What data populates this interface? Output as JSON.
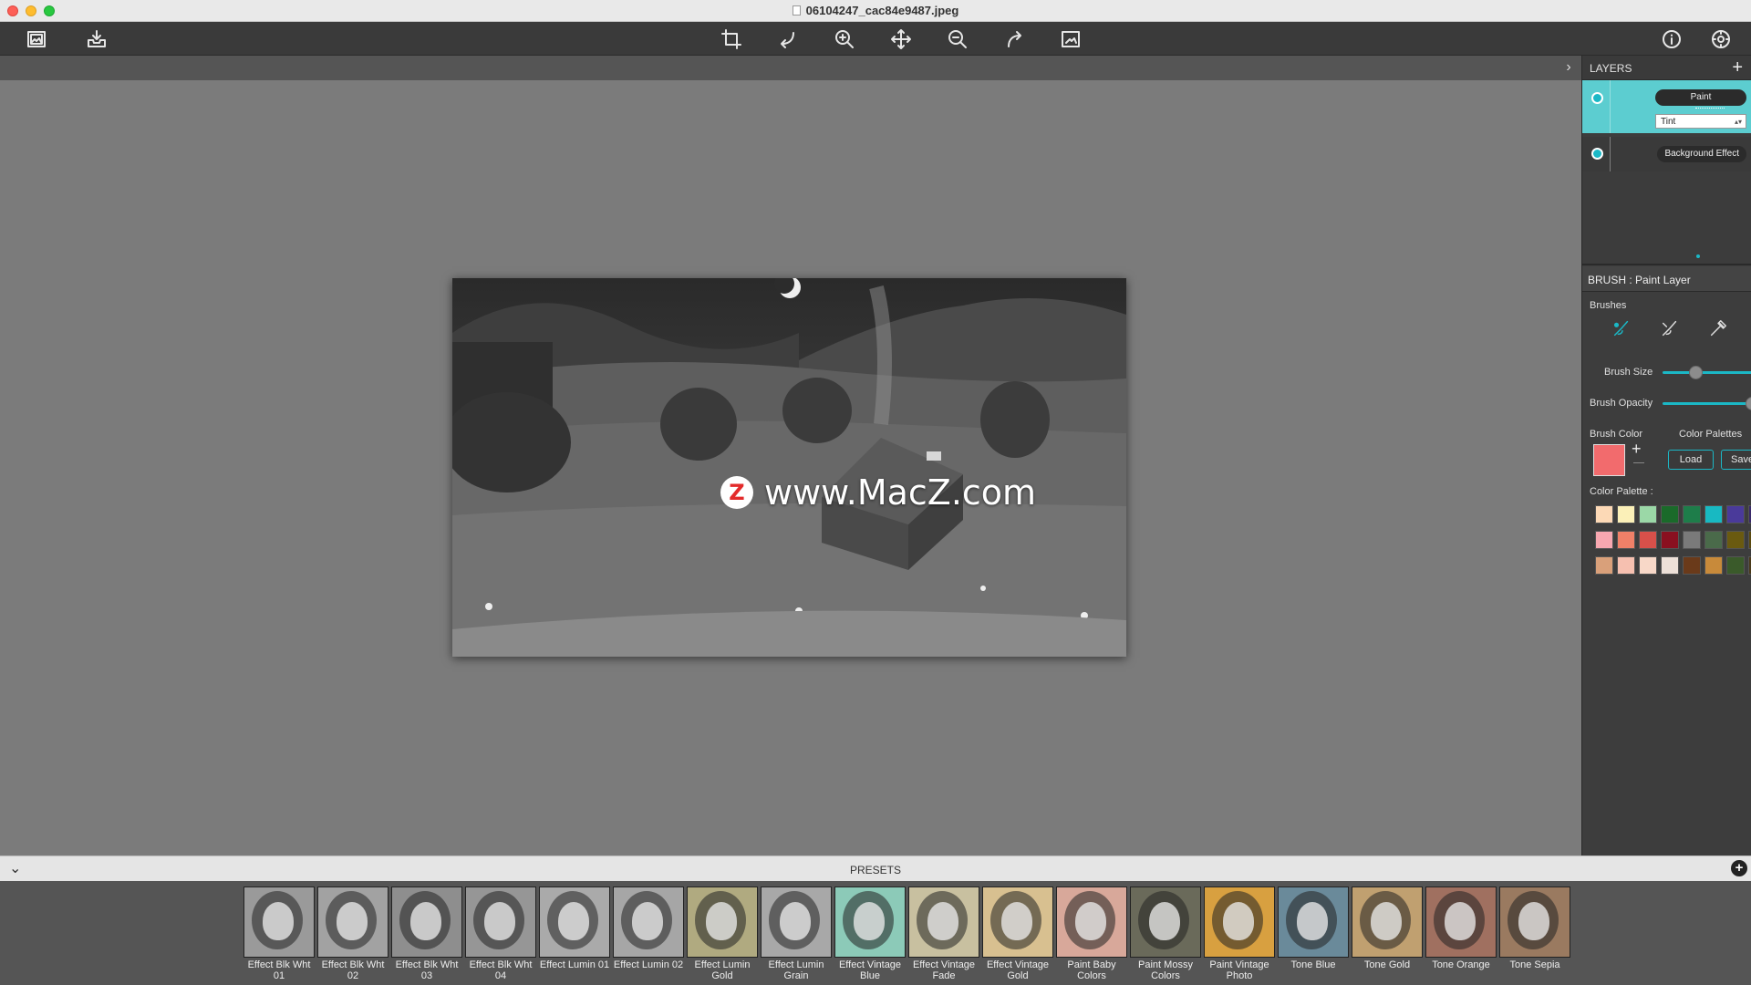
{
  "window": {
    "title": "06104247_cac84e9487.jpeg"
  },
  "watermark": {
    "logo": "Z",
    "text": "www.MacZ.com"
  },
  "layers": {
    "title": "LAYERS",
    "add_label": "+",
    "items": [
      {
        "button": "Paint",
        "blend": "Tint"
      },
      {
        "button": "Background Effect"
      }
    ]
  },
  "brush": {
    "header": "BRUSH : Paint Layer",
    "brushes_label": "Brushes",
    "size_label": "Brush Size",
    "size_value": 0.37,
    "opacity_label": "Brush Opacity",
    "opacity_value": 1.0,
    "color_label": "Brush Color",
    "color": "#f26b6d",
    "palettes_label": "Color Palettes",
    "load_label": "Load",
    "save_label": "Save",
    "palette_label": "Color Palette :",
    "palette": [
      [
        "#fcd9b6",
        "#fbf0b8",
        "#9bd8a7",
        "#1a6a2a",
        "#1e7d4a",
        "#18b9c2",
        "#4a3a9a",
        "#3a2a6a"
      ],
      [
        "#f7a7b0",
        "#f08068",
        "#d8504a",
        "#8a1020",
        "#7a7a7a",
        "#4a6a4a",
        "#6a5a10",
        "#5a4a10"
      ],
      [
        "#d9a07a",
        "#f6c0b0",
        "#f8d8c8",
        "#ede0d8",
        "#6a3a1a",
        "#c88a3a",
        "#3a5a2a",
        "#4a3a1a"
      ]
    ]
  },
  "presets": {
    "title": "PRESETS",
    "collapse_label": "⌄",
    "add_label": "+",
    "items": [
      {
        "label": "Effect Blk Wht 01",
        "tint": "#9a9a9a"
      },
      {
        "label": "Effect Blk Wht 02",
        "tint": "#a2a2a2"
      },
      {
        "label": "Effect Blk Wht 03",
        "tint": "#8e8e8e"
      },
      {
        "label": "Effect Blk Wht 04",
        "tint": "#969696"
      },
      {
        "label": "Effect Lumin 01",
        "tint": "#aaaaaa"
      },
      {
        "label": "Effect Lumin 02",
        "tint": "#a6a6a6"
      },
      {
        "label": "Effect Lumin Gold",
        "tint": "#b0aa80"
      },
      {
        "label": "Effect Lumin Grain",
        "tint": "#a8a8a8"
      },
      {
        "label": "Effect Vintage Blue",
        "tint": "#8ccab8"
      },
      {
        "label": "Effect Vintage Fade",
        "tint": "#c8c0a0"
      },
      {
        "label": "Effect Vintage Gold",
        "tint": "#d8c090"
      },
      {
        "label": "Paint Baby Colors",
        "tint": "#d8a89a"
      },
      {
        "label": "Paint Mossy Colors",
        "tint": "#6a6a5a"
      },
      {
        "label": "Paint Vintage Photo",
        "tint": "#d8a040"
      },
      {
        "label": "Tone Blue",
        "tint": "#6a8a9a"
      },
      {
        "label": "Tone Gold",
        "tint": "#c0a070"
      },
      {
        "label": "Tone Orange",
        "tint": "#a07060"
      },
      {
        "label": "Tone Sepia",
        "tint": "#9a7a60"
      }
    ]
  }
}
